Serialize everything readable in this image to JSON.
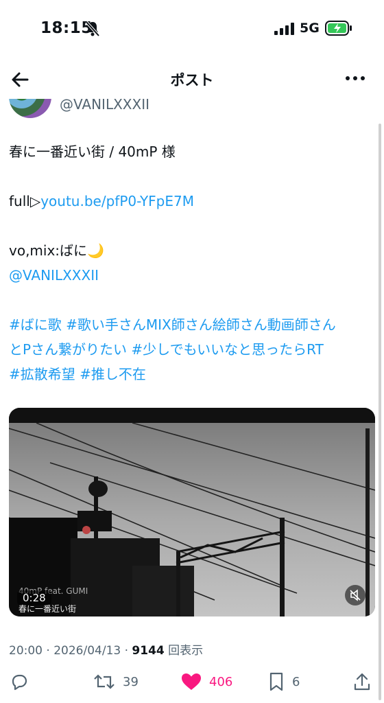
{
  "status_bar": {
    "time": "18:15",
    "network": "5G"
  },
  "header": {
    "title": "ポスト"
  },
  "author": {
    "handle": "@VANILXXXII"
  },
  "tweet": {
    "line1": "春に一番近い街 / 40mP 様",
    "full_prefix": "full▷",
    "full_link": "youtu.be/pfP0-YFpE7M",
    "vo_mix": "vo,mix:ばに🌙",
    "mention": "@VANILXXXII",
    "hashtags_line1": "#ばに歌 #歌い手さんMIX師さん絵師さん動画師さん",
    "hashtags_line2": "とPさん繋がりたい #少しでもいいなと思ったらRT",
    "hashtags_line3": "#拡散希望 #推し不在"
  },
  "video": {
    "elapsed": "0:28",
    "caption_artist": "40mP feat. GUMI",
    "caption_title": "春に一番近い街"
  },
  "meta": {
    "time": "20:00",
    "date": "2026/04/13",
    "views_count": "9144",
    "views_label": "回表示",
    "separator": "·"
  },
  "actions": {
    "retweets": "39",
    "likes": "406",
    "bookmarks": "6"
  },
  "colors": {
    "link": "#1d9bf0",
    "like": "#f91880",
    "muted": "#536471"
  }
}
